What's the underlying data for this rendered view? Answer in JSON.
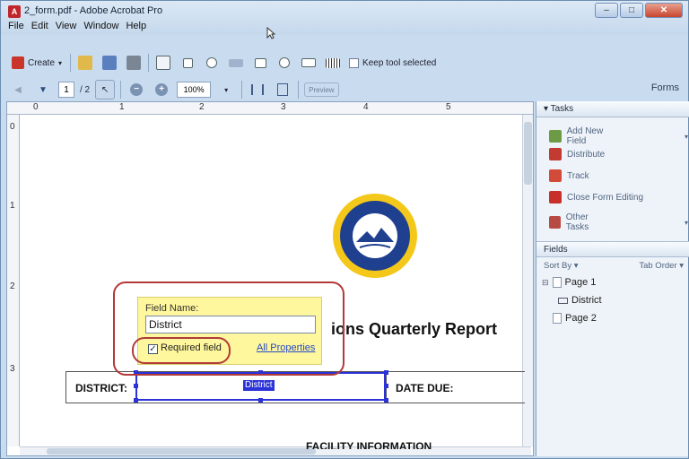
{
  "window": {
    "title": "2_form.pdf - Adobe Acrobat Pro",
    "minimize": "–",
    "maximize": "□",
    "close": "✕"
  },
  "menu": [
    "File",
    "Edit",
    "View",
    "Window",
    "Help"
  ],
  "toolbar": {
    "create_label": "Create",
    "keep_tool_label": "Keep tool selected",
    "keep_tool_checked": false
  },
  "nav": {
    "page_current": "1",
    "page_total": "/ 2",
    "zoom": "100%",
    "forms_label": "Forms",
    "preview_label": "Preview"
  },
  "document": {
    "ruler_top": [
      "0",
      "1",
      "2",
      "3",
      "4",
      "5"
    ],
    "ruler_left": [
      "0",
      "1",
      "2",
      "3"
    ],
    "report_title": "ions Quarterly Report",
    "district_label": "DISTRICT:",
    "date_due_label": "DATE DUE:",
    "field_chip": "District",
    "bottom_heading": "FACILITY INFORMATION"
  },
  "field_popup": {
    "field_name_label": "Field Name:",
    "field_name_value": "District",
    "required_label": "Required field",
    "required_checked": true,
    "all_properties": "All Properties"
  },
  "tasks": {
    "header": "▾ Tasks",
    "items": [
      "Add New Field",
      "Distribute",
      "Track",
      "Close Form Editing",
      "Other Tasks"
    ]
  },
  "fields": {
    "header": "Fields",
    "sort_by": "Sort By ▾",
    "tab_order": "Tab Order ▾",
    "tree": [
      {
        "label": "Page 1"
      },
      {
        "label": "District"
      },
      {
        "label": "Page 2"
      }
    ]
  },
  "colors": {
    "accent_blue": "#2a32d8",
    "annotation_red": "#b23a3a",
    "tooltip_yellow": "#fff79d",
    "seal_gold": "#f4c81a",
    "seal_blue": "#1f3f8f"
  }
}
